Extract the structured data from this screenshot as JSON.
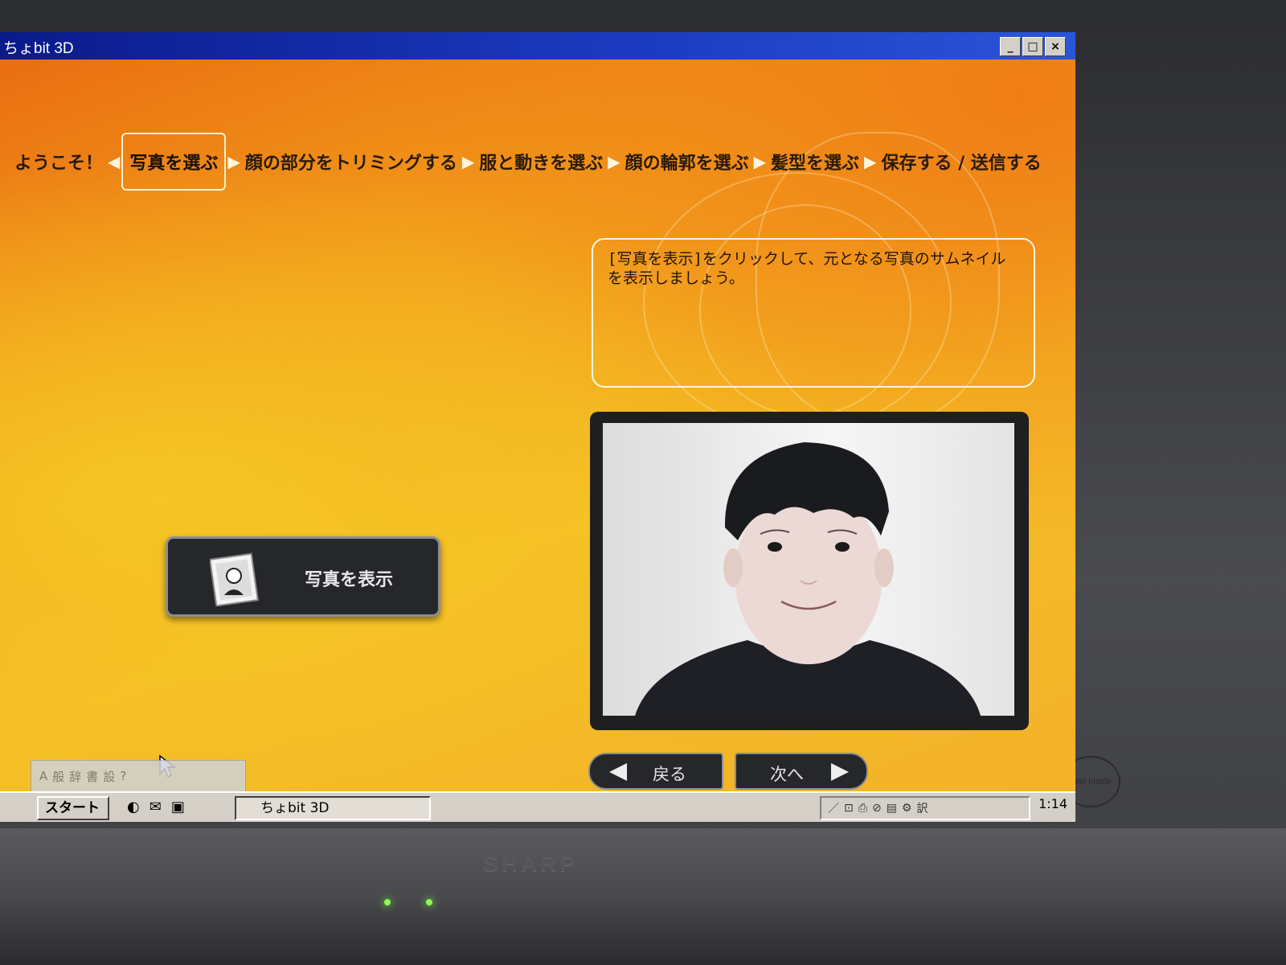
{
  "window": {
    "title": "ちょbit 3D",
    "minimize": "_",
    "maximize": "□",
    "close": "×"
  },
  "steps": [
    {
      "label": "ようこそ！",
      "active": false
    },
    {
      "label": "写真を選ぶ",
      "active": true
    },
    {
      "label": "顔の部分をトリミングする",
      "active": false
    },
    {
      "label": "服と動きを選ぶ",
      "active": false
    },
    {
      "label": "顔の輪郭を選ぶ",
      "active": false
    },
    {
      "label": "髪型を選ぶ",
      "active": false
    },
    {
      "label": "保存する / 送信する",
      "active": false
    }
  ],
  "arrows": {
    "back": "◀",
    "forward": "▶"
  },
  "instruction": "[写真を表示]をクリックして、元となる写真のサムネイルを表示しましょう。",
  "show_photo_button": {
    "label": "写真を表示",
    "icon": "photo-icon"
  },
  "nav": {
    "back_label": "戻る",
    "next_label": "次へ"
  },
  "taskbar": {
    "start_label": "スタート",
    "task_label": "ちょbit 3D",
    "clock": "1:14",
    "tray_icons": [
      "pen-icon",
      "network-icon",
      "printer-icon",
      "disk-icon",
      "monitor-icon",
      "ime-icon",
      "translate-icon"
    ]
  },
  "ime_toolbar": {
    "items": [
      "A",
      "般",
      "辞",
      "書",
      "設",
      "?"
    ]
  },
  "monitor": {
    "brand": "SHARP",
    "sticker": "intel inside"
  },
  "colors": {
    "titlebar": "#0a1a8a",
    "app_orange": "#ea6e12",
    "app_yellow": "#f5c524",
    "button_dark": "#26272a"
  }
}
